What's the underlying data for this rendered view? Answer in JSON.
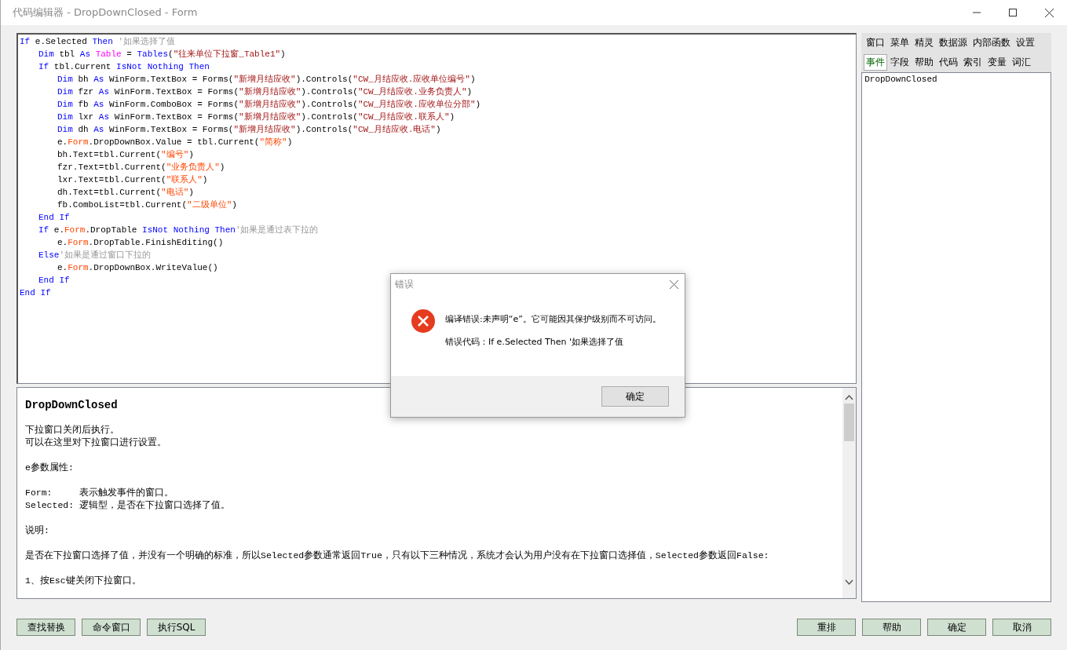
{
  "window": {
    "title": "代码编辑器 - DropDownClosed - Form"
  },
  "code_lines": [
    {
      "tokens": [
        {
          "kind": "kw",
          "text": "If"
        },
        {
          "kind": "plain",
          "text": " e.Selected "
        },
        {
          "kind": "kw",
          "text": "Then"
        },
        {
          "kind": "comment",
          "text": " '如果选择了值"
        }
      ],
      "children": [
        {
          "tokens": [
            {
              "kind": "kw",
              "text": "Dim"
            },
            {
              "kind": "plain",
              "text": " tbl "
            },
            {
              "kind": "kw",
              "text": "As "
            },
            {
              "kind": "type",
              "text": "Table"
            },
            {
              "kind": "plain",
              "text": " = "
            },
            {
              "kind": "kw",
              "text": "Tables"
            },
            {
              "kind": "plain",
              "text": "("
            },
            {
              "kind": "str",
              "text": "\"往来单位下拉窗_Table1\""
            },
            {
              "kind": "plain",
              "text": ")"
            }
          ]
        },
        {
          "tokens": [
            {
              "kind": "kw",
              "text": "If"
            },
            {
              "kind": "plain",
              "text": " tbl.Current "
            },
            {
              "kind": "kw",
              "text": "IsNot Nothing Then"
            }
          ],
          "children": [
            {
              "tokens": [
                {
                  "kind": "kw",
                  "text": "Dim"
                },
                {
                  "kind": "plain",
                  "text": " bh "
                },
                {
                  "kind": "kw",
                  "text": "As"
                },
                {
                  "kind": "plain",
                  "text": " WinForm.TextBox = Forms("
                },
                {
                  "kind": "str",
                  "text": "\"新增月结应收\""
                },
                {
                  "kind": "plain",
                  "text": ").Controls("
                },
                {
                  "kind": "str",
                  "text": "\"CW_月结应收.应收单位编号\""
                },
                {
                  "kind": "plain",
                  "text": ")"
                }
              ]
            },
            {
              "tokens": [
                {
                  "kind": "kw",
                  "text": "Dim"
                },
                {
                  "kind": "plain",
                  "text": " fzr "
                },
                {
                  "kind": "kw",
                  "text": "As"
                },
                {
                  "kind": "plain",
                  "text": " WinForm.TextBox = Forms("
                },
                {
                  "kind": "str",
                  "text": "\"新增月结应收\""
                },
                {
                  "kind": "plain",
                  "text": ").Controls("
                },
                {
                  "kind": "str",
                  "text": "\"CW_月结应收.业务负责人\""
                },
                {
                  "kind": "plain",
                  "text": ")"
                }
              ]
            },
            {
              "tokens": [
                {
                  "kind": "kw",
                  "text": "Dim"
                },
                {
                  "kind": "plain",
                  "text": " fb "
                },
                {
                  "kind": "kw",
                  "text": "As"
                },
                {
                  "kind": "plain",
                  "text": " WinForm.ComboBox = Forms("
                },
                {
                  "kind": "str",
                  "text": "\"新增月结应收\""
                },
                {
                  "kind": "plain",
                  "text": ").Controls("
                },
                {
                  "kind": "str",
                  "text": "\"CW_月结应收.应收单位分部\""
                },
                {
                  "kind": "plain",
                  "text": ")"
                }
              ]
            },
            {
              "tokens": [
                {
                  "kind": "kw",
                  "text": "Dim"
                },
                {
                  "kind": "plain",
                  "text": " lxr "
                },
                {
                  "kind": "kw",
                  "text": "As"
                },
                {
                  "kind": "plain",
                  "text": " WinForm.TextBox = Forms("
                },
                {
                  "kind": "str",
                  "text": "\"新增月结应收\""
                },
                {
                  "kind": "plain",
                  "text": ").Controls("
                },
                {
                  "kind": "str",
                  "text": "\"CW_月结应收.联系人\""
                },
                {
                  "kind": "plain",
                  "text": ")"
                }
              ]
            },
            {
              "tokens": [
                {
                  "kind": "kw",
                  "text": "Dim"
                },
                {
                  "kind": "plain",
                  "text": " dh "
                },
                {
                  "kind": "kw",
                  "text": "As"
                },
                {
                  "kind": "plain",
                  "text": " WinForm.TextBox = Forms("
                },
                {
                  "kind": "str",
                  "text": "\"新增月结应收\""
                },
                {
                  "kind": "plain",
                  "text": ").Controls("
                },
                {
                  "kind": "str",
                  "text": "\"CW_月结应收.电话\""
                },
                {
                  "kind": "plain",
                  "text": ")"
                }
              ]
            },
            {
              "tokens": [
                {
                  "kind": "plain",
                  "text": "e."
                },
                {
                  "kind": "member",
                  "text": "Form"
                },
                {
                  "kind": "plain",
                  "text": ".DropDownBox.Value = tbl.Current("
                },
                {
                  "kind": "str2",
                  "text": "\"简称\""
                },
                {
                  "kind": "plain",
                  "text": ")"
                }
              ]
            },
            {
              "tokens": [
                {
                  "kind": "plain",
                  "text": "bh.Text=tbl.Current("
                },
                {
                  "kind": "str2",
                  "text": "\"编号\""
                },
                {
                  "kind": "plain",
                  "text": ")"
                }
              ]
            },
            {
              "tokens": [
                {
                  "kind": "plain",
                  "text": "fzr.Text=tbl.Current("
                },
                {
                  "kind": "str2",
                  "text": "\"业务负责人\""
                },
                {
                  "kind": "plain",
                  "text": ")"
                }
              ]
            },
            {
              "tokens": [
                {
                  "kind": "plain",
                  "text": "lxr.Text=tbl.Current("
                },
                {
                  "kind": "str2",
                  "text": "\"联系人\""
                },
                {
                  "kind": "plain",
                  "text": ")"
                }
              ]
            },
            {
              "tokens": [
                {
                  "kind": "plain",
                  "text": "dh.Text=tbl.Current("
                },
                {
                  "kind": "str2",
                  "text": "\"电话\""
                },
                {
                  "kind": "plain",
                  "text": ")"
                }
              ]
            },
            {
              "tokens": [
                {
                  "kind": "plain",
                  "text": "fb.ComboList=tbl.Current("
                },
                {
                  "kind": "str2",
                  "text": "\"二级单位\""
                },
                {
                  "kind": "plain",
                  "text": ")"
                }
              ]
            }
          ]
        },
        {
          "tokens": [
            {
              "kind": "kw",
              "text": "End If"
            }
          ]
        },
        {
          "tokens": [
            {
              "kind": "kw",
              "text": "If"
            },
            {
              "kind": "plain",
              "text": " e."
            },
            {
              "kind": "member",
              "text": "Form"
            },
            {
              "kind": "plain",
              "text": ".DropTable "
            },
            {
              "kind": "kw",
              "text": "IsNot Nothing Then"
            },
            {
              "kind": "comment",
              "text": "'如果是通过表下拉的"
            }
          ],
          "children": [
            {
              "tokens": [
                {
                  "kind": "plain",
                  "text": "e."
                },
                {
                  "kind": "member",
                  "text": "Form"
                },
                {
                  "kind": "plain",
                  "text": ".DropTable.FinishEditing()"
                }
              ]
            }
          ]
        },
        {
          "tokens": [
            {
              "kind": "kw",
              "text": "Else"
            },
            {
              "kind": "comment",
              "text": "'如果是通过窗口下拉的"
            }
          ],
          "children": [
            {
              "tokens": [
                {
                  "kind": "plain",
                  "text": "e."
                },
                {
                  "kind": "member",
                  "text": "Form"
                },
                {
                  "kind": "plain",
                  "text": ".DropDownBox.WriteValue()"
                }
              ]
            }
          ]
        },
        {
          "tokens": [
            {
              "kind": "kw",
              "text": "End If"
            }
          ]
        }
      ]
    },
    {
      "tokens": [
        {
          "kind": "kw",
          "text": "End If"
        }
      ]
    }
  ],
  "help": {
    "title": "DropDownClosed",
    "paragraphs": [
      [
        "下拉窗口关闭后执行。",
        "可以在这里对下拉窗口进行设置。"
      ],
      [
        "e参数属性:"
      ],
      [
        "Form:     表示触发事件的窗口。",
        "Selected: 逻辑型，是否在下拉窗口选择了值。"
      ],
      [
        "说明:"
      ],
      [
        "是否在下拉窗口选择了值，并没有一个明确的标准，所以Selected参数通常返回True，只有以下三种情况，系统才会认为用户没有在下拉窗口选择值，Selected参数返回False:"
      ],
      [
        "1、按Esc键关闭下拉窗口。"
      ]
    ]
  },
  "side_tabs": [
    [
      {
        "label": "窗口",
        "selected": false
      },
      {
        "label": "菜单",
        "selected": false
      },
      {
        "label": "精灵",
        "selected": false
      },
      {
        "label": "数据源",
        "selected": false
      },
      {
        "label": "内部函数",
        "selected": false
      },
      {
        "label": "设置",
        "selected": false
      }
    ],
    [
      {
        "label": "事件",
        "selected": true
      },
      {
        "label": "字段",
        "selected": false
      },
      {
        "label": "帮助",
        "selected": false
      },
      {
        "label": "代码",
        "selected": false
      },
      {
        "label": "索引",
        "selected": false
      },
      {
        "label": "变量",
        "selected": false
      },
      {
        "label": "词汇",
        "selected": false
      }
    ]
  ],
  "side_list": [
    "DropDownClosed"
  ],
  "left_buttons": [
    "查找替换",
    "命令窗口",
    "执行SQL"
  ],
  "right_buttons": [
    "重排",
    "帮助",
    "确定",
    "取消"
  ],
  "dialog": {
    "title": "错误",
    "message": "编译错误:未声明“e”。它可能因其保护级别而不可访问。",
    "detail": "错误代码：If e.Selected Then  '如果选择了值",
    "button": "确定"
  }
}
